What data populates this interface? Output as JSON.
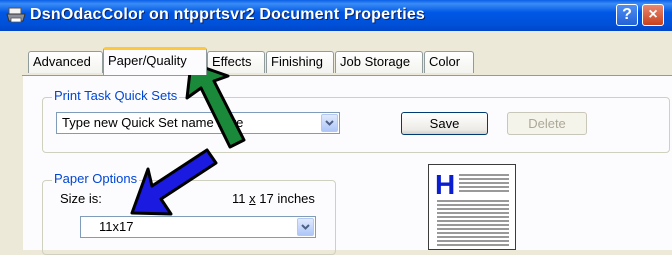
{
  "window": {
    "title": "DsnOdacColor on ntpprtsvr2 Document Properties",
    "help_label": "?",
    "close_label": "×"
  },
  "tabs": [
    {
      "label": "Advanced"
    },
    {
      "label": "Paper/Quality",
      "active": true
    },
    {
      "label": "Effects"
    },
    {
      "label": "Finishing"
    },
    {
      "label": "Job Storage"
    },
    {
      "label": "Color"
    }
  ],
  "quick_sets": {
    "group_label": "Print Task Quick Sets",
    "combo_value": "Type new Quick Set name here",
    "save_label": "Save",
    "delete_label": "Delete"
  },
  "paper_options": {
    "group_label": "Paper Options",
    "size_label": "Size is:",
    "size_value_num": "11",
    "size_value_x": "x",
    "size_value_rest": "17 inches",
    "size_combo_value": "11x17"
  },
  "preview": {
    "letter": "H"
  },
  "annotations": {
    "green_arrow_color": "#1a8a3a",
    "blue_arrow_color": "#1a1ae0"
  }
}
